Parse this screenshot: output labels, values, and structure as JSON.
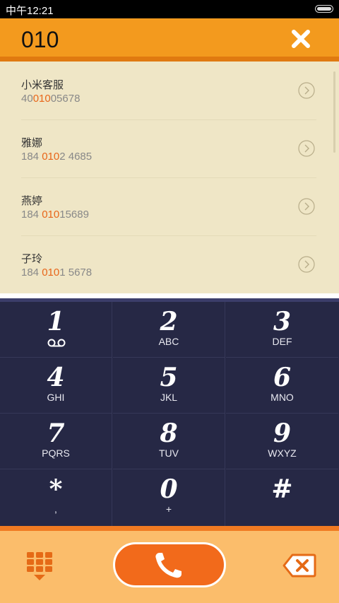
{
  "status_bar": {
    "time": "中午12:21"
  },
  "dial_input": {
    "value": "010"
  },
  "results": [
    {
      "name": "小米客服",
      "number_pre": "40",
      "number_match": "010",
      "number_post": "05678"
    },
    {
      "name": "雅娜",
      "number_pre": "184 ",
      "number_match": "010",
      "number_post": "2 4685"
    },
    {
      "name": "燕婷",
      "number_pre": "184 ",
      "number_match": "010",
      "number_post": "15689"
    },
    {
      "name": "子玲",
      "number_pre": "184 ",
      "number_match": "010",
      "number_post": "1 5678"
    }
  ],
  "keys": [
    {
      "digit": "1",
      "letters": ""
    },
    {
      "digit": "2",
      "letters": "ABC"
    },
    {
      "digit": "3",
      "letters": "DEF"
    },
    {
      "digit": "4",
      "letters": "GHI"
    },
    {
      "digit": "5",
      "letters": "JKL"
    },
    {
      "digit": "6",
      "letters": "MNO"
    },
    {
      "digit": "7",
      "letters": "PQRS"
    },
    {
      "digit": "8",
      "letters": "TUV"
    },
    {
      "digit": "9",
      "letters": "WXYZ"
    },
    {
      "digit": "*",
      "letters": ","
    },
    {
      "digit": "0",
      "letters": "+"
    },
    {
      "digit": "#",
      "letters": ""
    }
  ],
  "icons": {
    "clear": "clear-x-icon",
    "voicemail": "voicemail-icon",
    "keypad_toggle": "dialpad-collapse-icon",
    "call": "phone-handset-icon",
    "backspace": "backspace-icon",
    "detail": "chevron-right-circle-icon"
  },
  "colors": {
    "header": "#f39a1e",
    "highlight": "#e8661a",
    "keypad": "#262845",
    "call": "#f26a1b",
    "bottom": "#fbbd6b"
  }
}
